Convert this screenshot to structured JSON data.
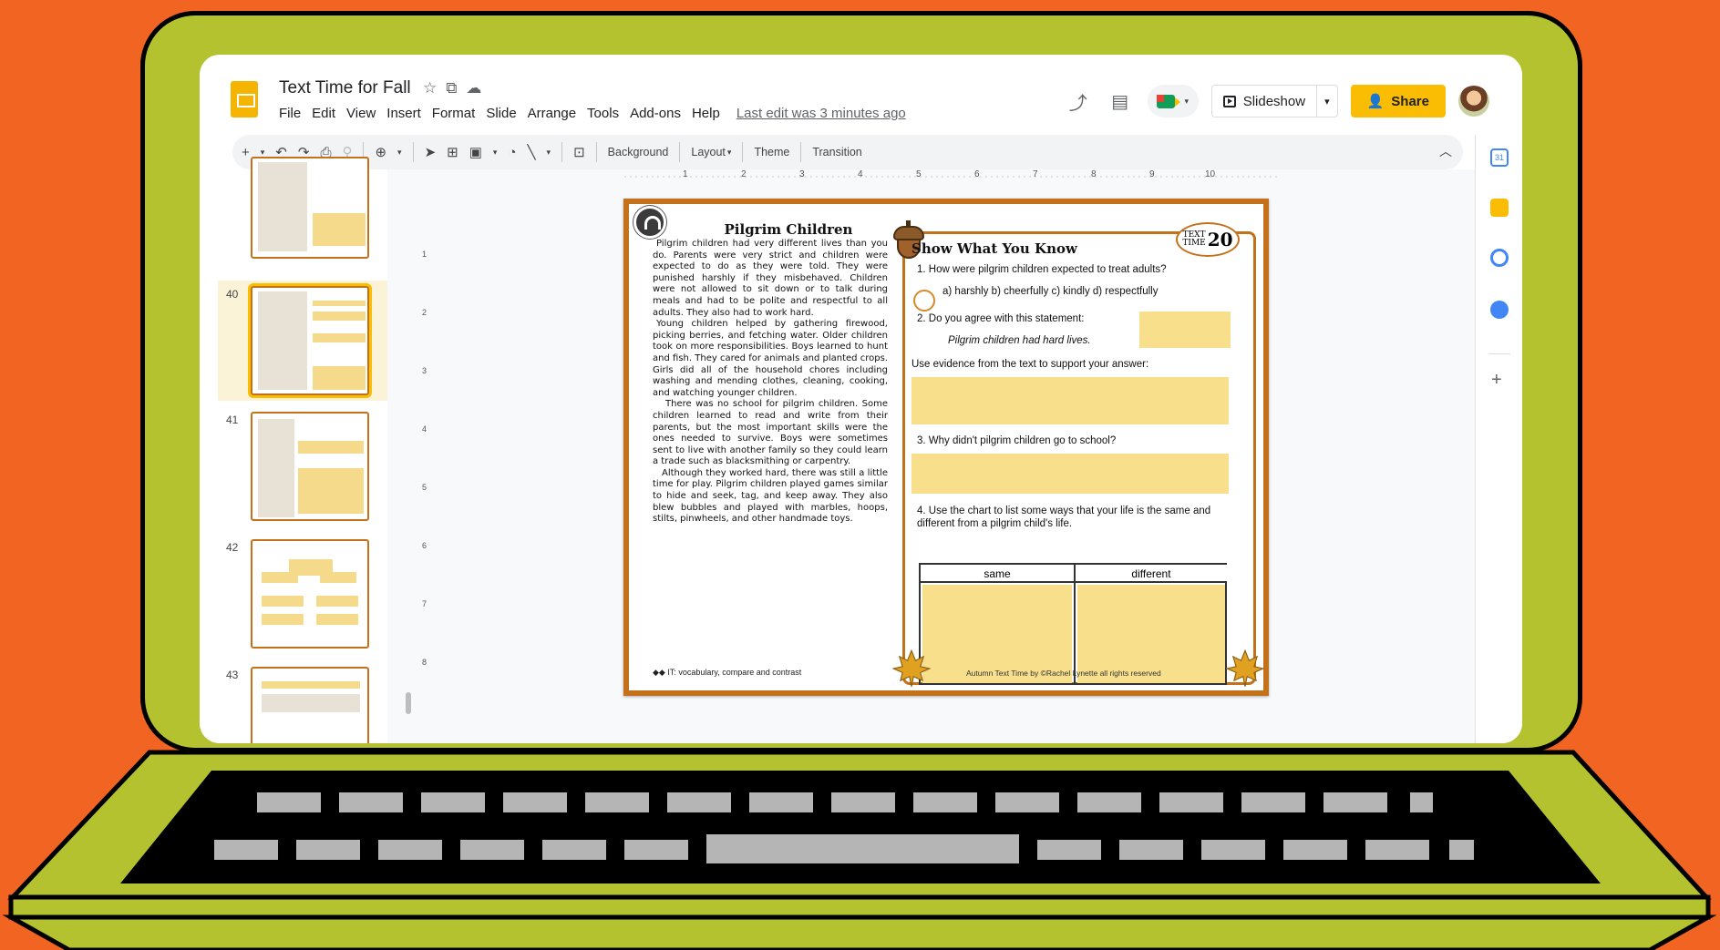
{
  "app": {
    "doc_title": "Text Time for Fall",
    "title_icons": [
      "star-icon",
      "move-to-folder-icon",
      "cloud-status-icon"
    ],
    "menu": [
      "File",
      "Edit",
      "View",
      "Insert",
      "Format",
      "Slide",
      "Arrange",
      "Tools",
      "Add-ons",
      "Help"
    ],
    "last_edit": "Last edit was 3 minutes ago",
    "slideshow_label": "Slideshow",
    "share_label": "Share",
    "accent": "#fbbc04"
  },
  "toolbar": {
    "background_label": "Background",
    "layout_label": "Layout",
    "theme_label": "Theme",
    "transition_label": "Transition"
  },
  "filmstrip": {
    "slide_numbers": [
      "40",
      "41",
      "42",
      "43"
    ],
    "selected": "40"
  },
  "ruler": {
    "top_ticks": [
      "1",
      "2",
      "3",
      "4",
      "5",
      "6",
      "7",
      "8",
      "9",
      "10"
    ],
    "left_ticks": [
      "1",
      "2",
      "3",
      "4",
      "5",
      "6",
      "7",
      "8"
    ]
  },
  "worksheet": {
    "title": "Pilgrim Children",
    "para1": "Pilgrim children had very different lives than you do. Parents were very strict and children were expected to do as they were told. They were punished harshly if they misbehaved. Children were not allowed to sit down or to talk during meals and had to be polite and respectful to all adults. They also had to work hard.",
    "para2": "Young children helped by gathering firewood, picking berries, and fetching water. Older children took on more responsibilities. Boys learned to hunt and fish. They cared for animals and planted crops. Girls did all of the household chores including washing and mending clothes, cleaning, cooking, and watching younger children.",
    "para3": "There was no school for pilgrim children. Some children learned to read and write from their parents, but the most important skills were the ones needed to survive. Boys were sometimes sent to live with another family so they could learn a trade such as blacksmithing or carpentry.",
    "para4": "Although they worked hard, there was still a little time for play. Pilgrim children played games similar to hide and seek, tag, and keep away. They also blew bubbles and played with marbles, hoops, stilts, pinwheels, and other handmade toys.",
    "it_note": "◆◆ IT: vocabulary, compare and contrast",
    "badge_top": "TEXT",
    "badge_mid": "TIME",
    "badge_num": "20",
    "section_title": "Show What You Know",
    "q1": "1.   How were pilgrim children expected to treat adults?",
    "q1_options": "a) harshly   b) cheerfully   c) kindly   d) respectfully",
    "q2": "2.   Do you agree with this statement:",
    "q2_statement": "Pilgrim children had hard lives.",
    "q2_evidence": "Use evidence from the text to support your answer:",
    "q3": "3.    Why didn't pilgrim children go to school?",
    "q4": "4.   Use the chart to list some ways that your life is the same and different from a pilgrim child's life.",
    "col_same": "same",
    "col_different": "different",
    "footer": "Autumn Text Time by ©Rachel Lynette all rights reserved"
  }
}
